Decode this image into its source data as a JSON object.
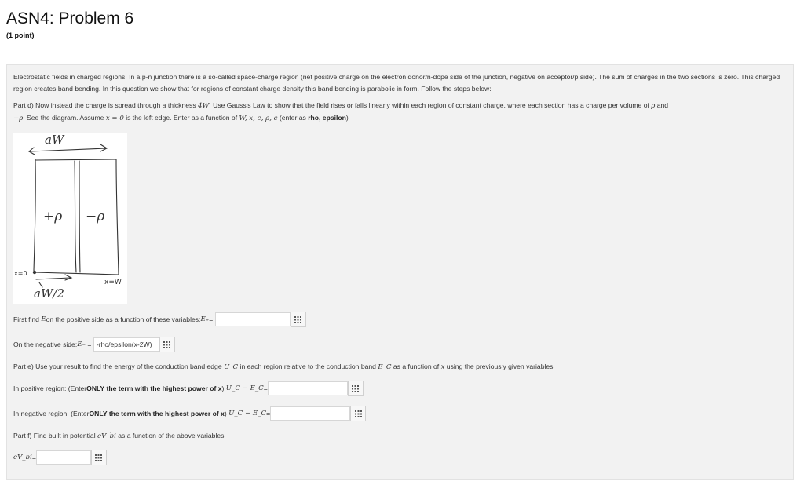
{
  "header": {
    "title": "ASN4: Problem 6",
    "points": "(1 point)"
  },
  "intro": "Electrostatic fields in charged regions: In a p-n junction there is a so-called space-charge region (net positive charge on the electron donor/n-dope side of the junction, negative on acceptor/p side). The sum of charges in the two sections is zero. This charged region creates band bending. In this question we show that for regions of constant charge density this band bending is parabolic in form. Follow the steps below:",
  "part_d": {
    "a": "Part d) Now instead the charge is spread through a thickness ",
    "m1": "4W",
    "b": ". Use Gauss's Law to show that the field rises or falls linearly within each region of constant charge, where each section has a charge per volume of ",
    "m2": "ρ",
    "c": " and",
    "m3": "−ρ",
    "d": ". See the diagram. Assume ",
    "m4": "x = 0",
    "e": " is the left edge. Enter as a function of ",
    "m5": "W, x, e, ρ, ϵ",
    "f": " (enter as ",
    "g": "rho, epsilon",
    "h": ")"
  },
  "diagram": {
    "top_label": "aW",
    "left_label": "+ρ",
    "right_label": "−ρ",
    "x0_label": "x=0",
    "xw_label": "x=W",
    "bottom_label": "aW/2"
  },
  "q1": {
    "text": "First find ",
    "sym": "E",
    "text2": " on the positive side as a function of these variables: ",
    "lhs": "E₊",
    "eq": "=",
    "value": ""
  },
  "q2": {
    "text": "On the negative side: ",
    "lhs": "E₋",
    "eq": "=",
    "value": "-rho/epsilon(x-2W)"
  },
  "part_e": {
    "a": "Part e) Use your result to find the energy of the conduction band edge ",
    "m1": "U_C",
    "b": " in each region relative to the conduction band ",
    "m2": "E_C",
    "c": " as a function of ",
    "m3": "x",
    "d": " using the previously given variables"
  },
  "q3": {
    "a": "In positive region: (Enter ",
    "b": "ONLY the term with the highest power of x",
    "c": ") ",
    "lhs": "U_C − E_C",
    "eq": "=",
    "value": ""
  },
  "q4": {
    "a": "In negative region: (Enter ",
    "b": "ONLY the term with the highest power of x",
    "c": ") ",
    "lhs": "U_C − E_C",
    "eq": "=",
    "value": ""
  },
  "part_f": {
    "a": "Part f) Find built in potential ",
    "m1": "eV_bi",
    "b": " as a function of the above variables"
  },
  "q5": {
    "lhs": "eV_bi",
    "eq": "=",
    "value": ""
  }
}
